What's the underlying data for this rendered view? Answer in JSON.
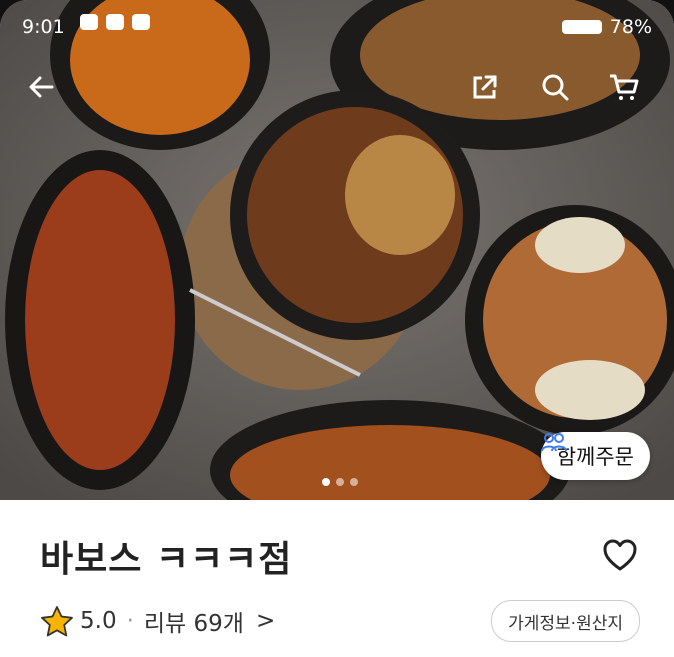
{
  "status_bar": {
    "time": "9:01",
    "battery": "78%"
  },
  "hero": {
    "icons": [
      "back-arrow-icon",
      "share-icon",
      "search-icon",
      "cart-icon"
    ],
    "together_order_label": "함께주문"
  },
  "store": {
    "name": "바보스 ㅋㅋㅋ점",
    "rating": "5.0",
    "review_label": "리뷰 69개",
    "review_chevron": ">",
    "info_button": "가게정보·원산지"
  },
  "colors": {
    "star": "#f7b500",
    "together_icon": "#3d7cf0"
  }
}
